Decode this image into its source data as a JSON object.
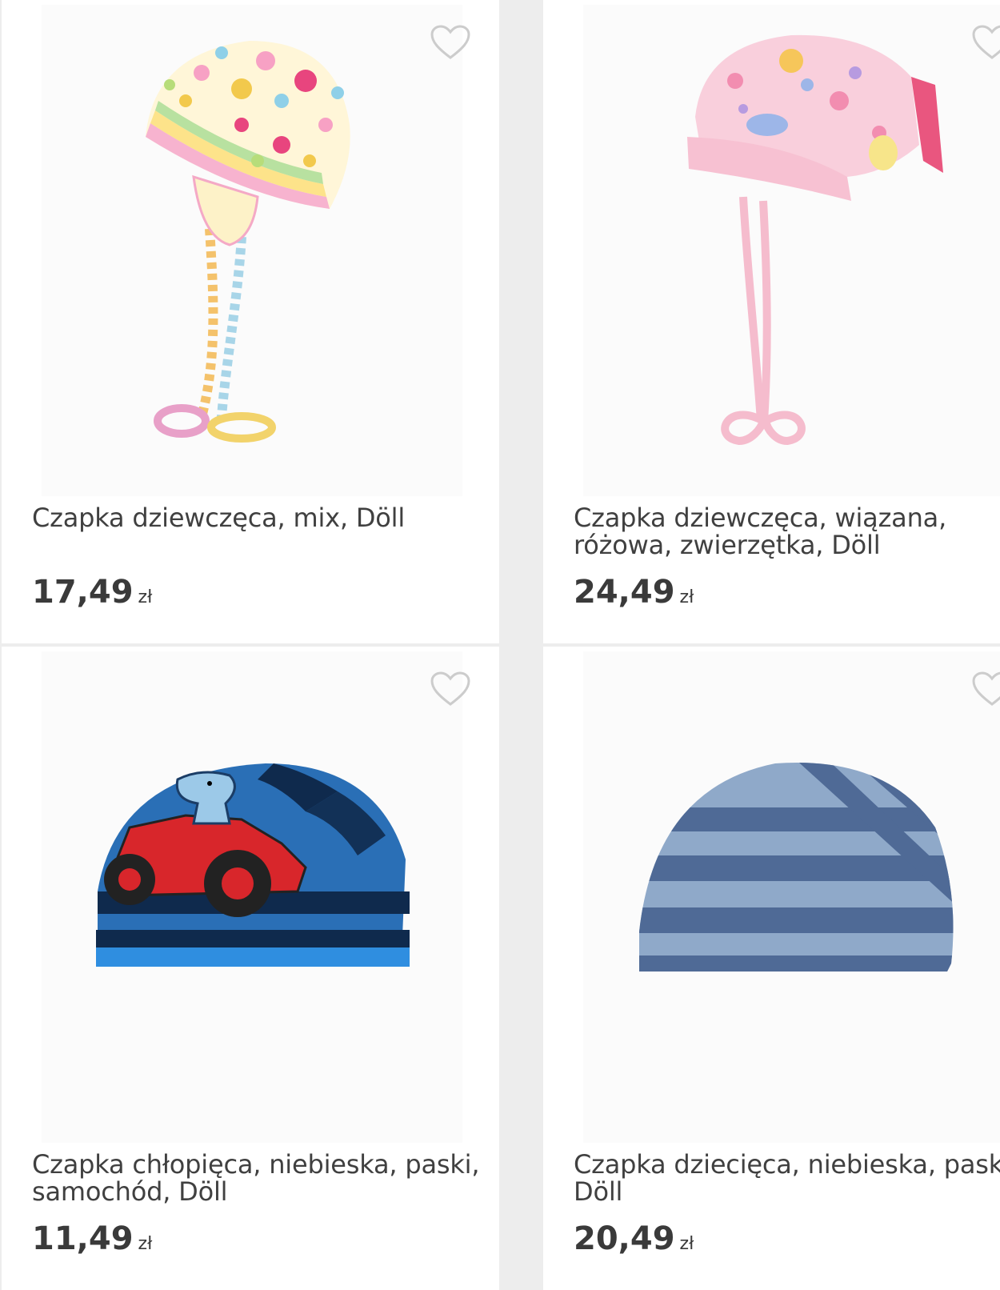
{
  "products": [
    {
      "title": "Czapka dziewczęca, mix, Döll",
      "price": "17,49",
      "currency": "zł",
      "image": "striped-dotted-girls-hat"
    },
    {
      "title": "Czapka dziewczęca, wiązana, różowa, zwierzętka, Döll",
      "price": "24,49",
      "currency": "zł",
      "image": "pink-animal-tied-hat"
    },
    {
      "title": "Czapka chłopięca, niebieska, paski, samochód, Döll",
      "price": "11,49",
      "currency": "zł",
      "image": "blue-striped-car-hat"
    },
    {
      "title": "Czapka dziecięca, niebieska, paski, Döll",
      "price": "20,49",
      "currency": "zł",
      "image": "blue-grey-striped-hat"
    }
  ],
  "icons": {
    "favorite": "heart-outline-icon"
  },
  "colors": {
    "background": "#ededed",
    "card": "#ffffff",
    "text": "#404040",
    "heart": "#cccccc"
  }
}
